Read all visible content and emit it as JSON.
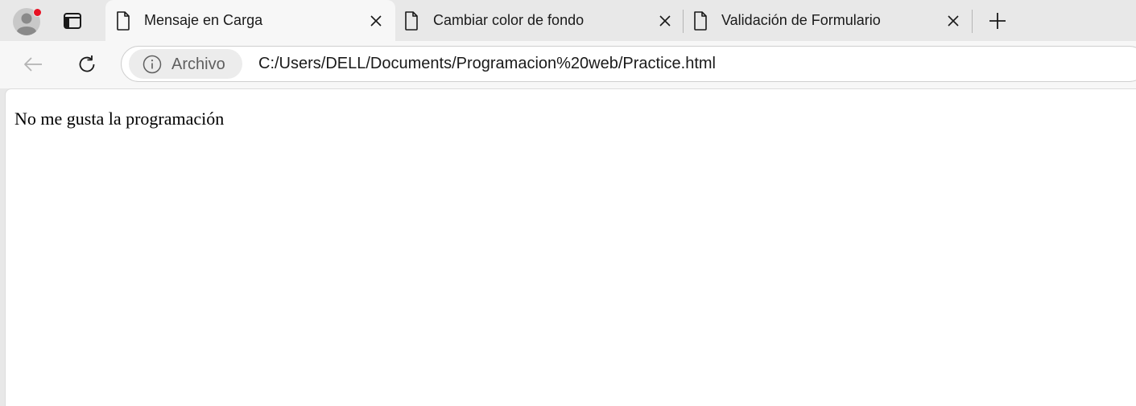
{
  "tabs": [
    {
      "title": "Mensaje en Carga",
      "active": true,
      "icon": "page-icon"
    },
    {
      "title": "Cambiar color de fondo",
      "active": false,
      "icon": "page-icon"
    },
    {
      "title": "Validación de Formulario",
      "active": false,
      "icon": "page-icon"
    }
  ],
  "toolbar": {
    "site_chip_label": "Archivo",
    "url": "C:/Users/DELL/Documents/Programacion%20web/Practice.html"
  },
  "page": {
    "text": "No me gusta la programación"
  },
  "colors": {
    "notification_dot": "#e81123",
    "tabstrip_bg": "#e8e8e8",
    "toolbar_bg": "#f7f7f7"
  }
}
